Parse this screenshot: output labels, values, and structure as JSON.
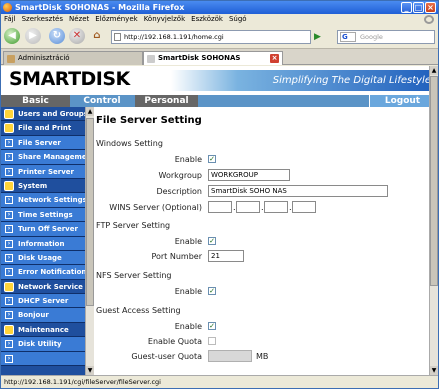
{
  "window": {
    "title": "SmartDisk SOHONAS - Mozilla Firefox"
  },
  "menu": [
    "Fájl",
    "Szerkesztés",
    "Nézet",
    "Előzmények",
    "Könyvjelzők",
    "Eszközök",
    "Súgó"
  ],
  "nav": {
    "url": "http://192.168.1.191/home.cgi",
    "search_placeholder": "Google",
    "search_engine": "G"
  },
  "tabs": [
    {
      "label": "Adminisztráció"
    },
    {
      "label": "SmartDisk SOHONAS"
    }
  ],
  "banner": {
    "logo": "SMARTDISK",
    "slogan": "Simplifying The Digital Lifestyle"
  },
  "topnav": {
    "basic": "Basic",
    "control_panel": "Control Panel",
    "personal_info": "Personal Info",
    "logout": "Logout"
  },
  "sidebar": [
    {
      "label": "Users and Groups",
      "type": "sec"
    },
    {
      "label": "File and Print",
      "type": "sec"
    },
    {
      "label": "File Server",
      "type": "sub"
    },
    {
      "label": "Share Management",
      "type": "sub"
    },
    {
      "label": "Printer Server",
      "type": "sub"
    },
    {
      "label": "System",
      "type": "sec"
    },
    {
      "label": "Network Settings",
      "type": "sub"
    },
    {
      "label": "Time Settings",
      "type": "sub"
    },
    {
      "label": "Turn Off Server",
      "type": "sub"
    },
    {
      "label": "Information",
      "type": "sub"
    },
    {
      "label": "Disk Usage",
      "type": "sub"
    },
    {
      "label": "Error Notification",
      "type": "sub"
    },
    {
      "label": "Network Service",
      "type": "sec"
    },
    {
      "label": "DHCP Server",
      "type": "sub"
    },
    {
      "label": "Bonjour",
      "type": "sub"
    },
    {
      "label": "Maintenance",
      "type": "sec"
    },
    {
      "label": "Disk Utility",
      "type": "sub"
    },
    {
      "label": "",
      "type": "sub"
    }
  ],
  "form": {
    "title": "File Server Setting",
    "windows": {
      "heading": "Windows Setting",
      "enable_label": "Enable",
      "workgroup_label": "Workgroup",
      "workgroup_value": "WORKGROUP",
      "description_label": "Description",
      "description_value": "SmartDisk SOHO NAS",
      "wins_label": "WINS Server (Optional)"
    },
    "ftp": {
      "heading": "FTP Server Setting",
      "enable_label": "Enable",
      "port_label": "Port Number",
      "port_value": "21"
    },
    "nfs": {
      "heading": "NFS Server Setting",
      "enable_label": "Enable"
    },
    "guest": {
      "heading": "Guest Access Setting",
      "enable_label": "Enable",
      "quota_label": "Enable Quota",
      "user_quota_label": "Guest-user Quota",
      "quota_unit": "MB"
    }
  },
  "status": {
    "text": "http://192.168.1.191/cgi/fileServer/fileServer.cgi"
  }
}
